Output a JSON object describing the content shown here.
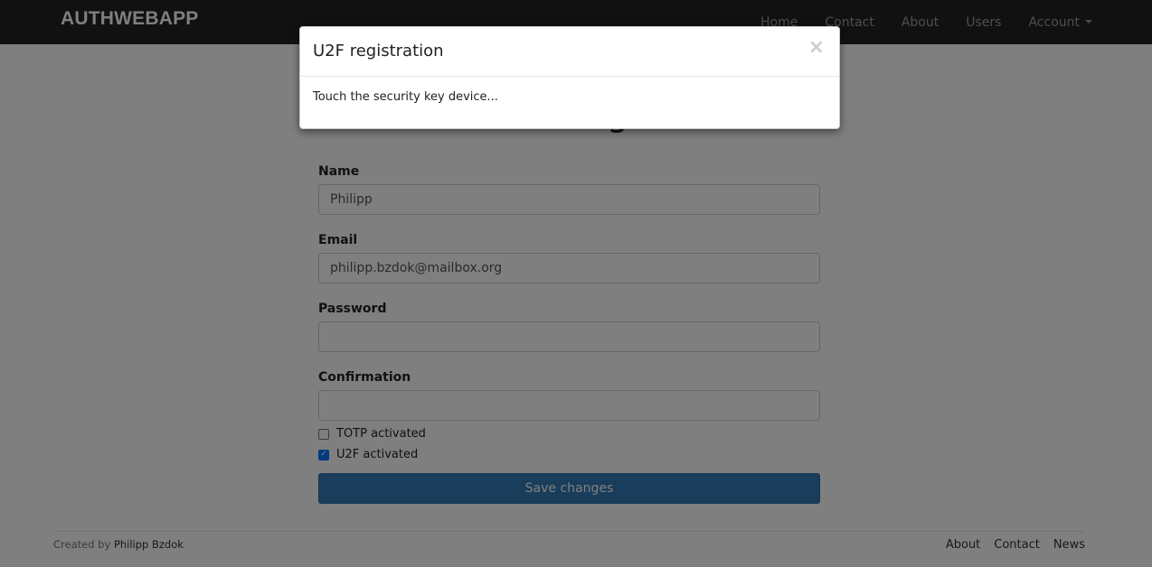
{
  "navbar": {
    "brand": "AUTHWEBAPP",
    "links": [
      "Home",
      "Contact",
      "About",
      "Users"
    ],
    "account_label": "Account"
  },
  "page": {
    "title": "Settings"
  },
  "form": {
    "name_label": "Name",
    "name_value": "Philipp",
    "email_label": "Email",
    "email_value": "philipp.bzdok@mailbox.org",
    "password_label": "Password",
    "password_value": "",
    "confirmation_label": "Confirmation",
    "confirmation_value": "",
    "totp_label": "TOTP activated",
    "totp_checked": false,
    "u2f_label": "U2F activated",
    "u2f_checked": true,
    "save_label": "Save changes"
  },
  "footer": {
    "created_by": "Created by",
    "author": "Philipp Bzdok",
    "links": [
      "About",
      "Contact",
      "News"
    ]
  },
  "modal": {
    "title": "U2F registration",
    "close_glyph": "×",
    "body": "Touch the security key device..."
  },
  "colors": {
    "navbar_bg": "#222222",
    "primary_button": "#337ab7",
    "checkbox_accent": "#0075ff"
  }
}
